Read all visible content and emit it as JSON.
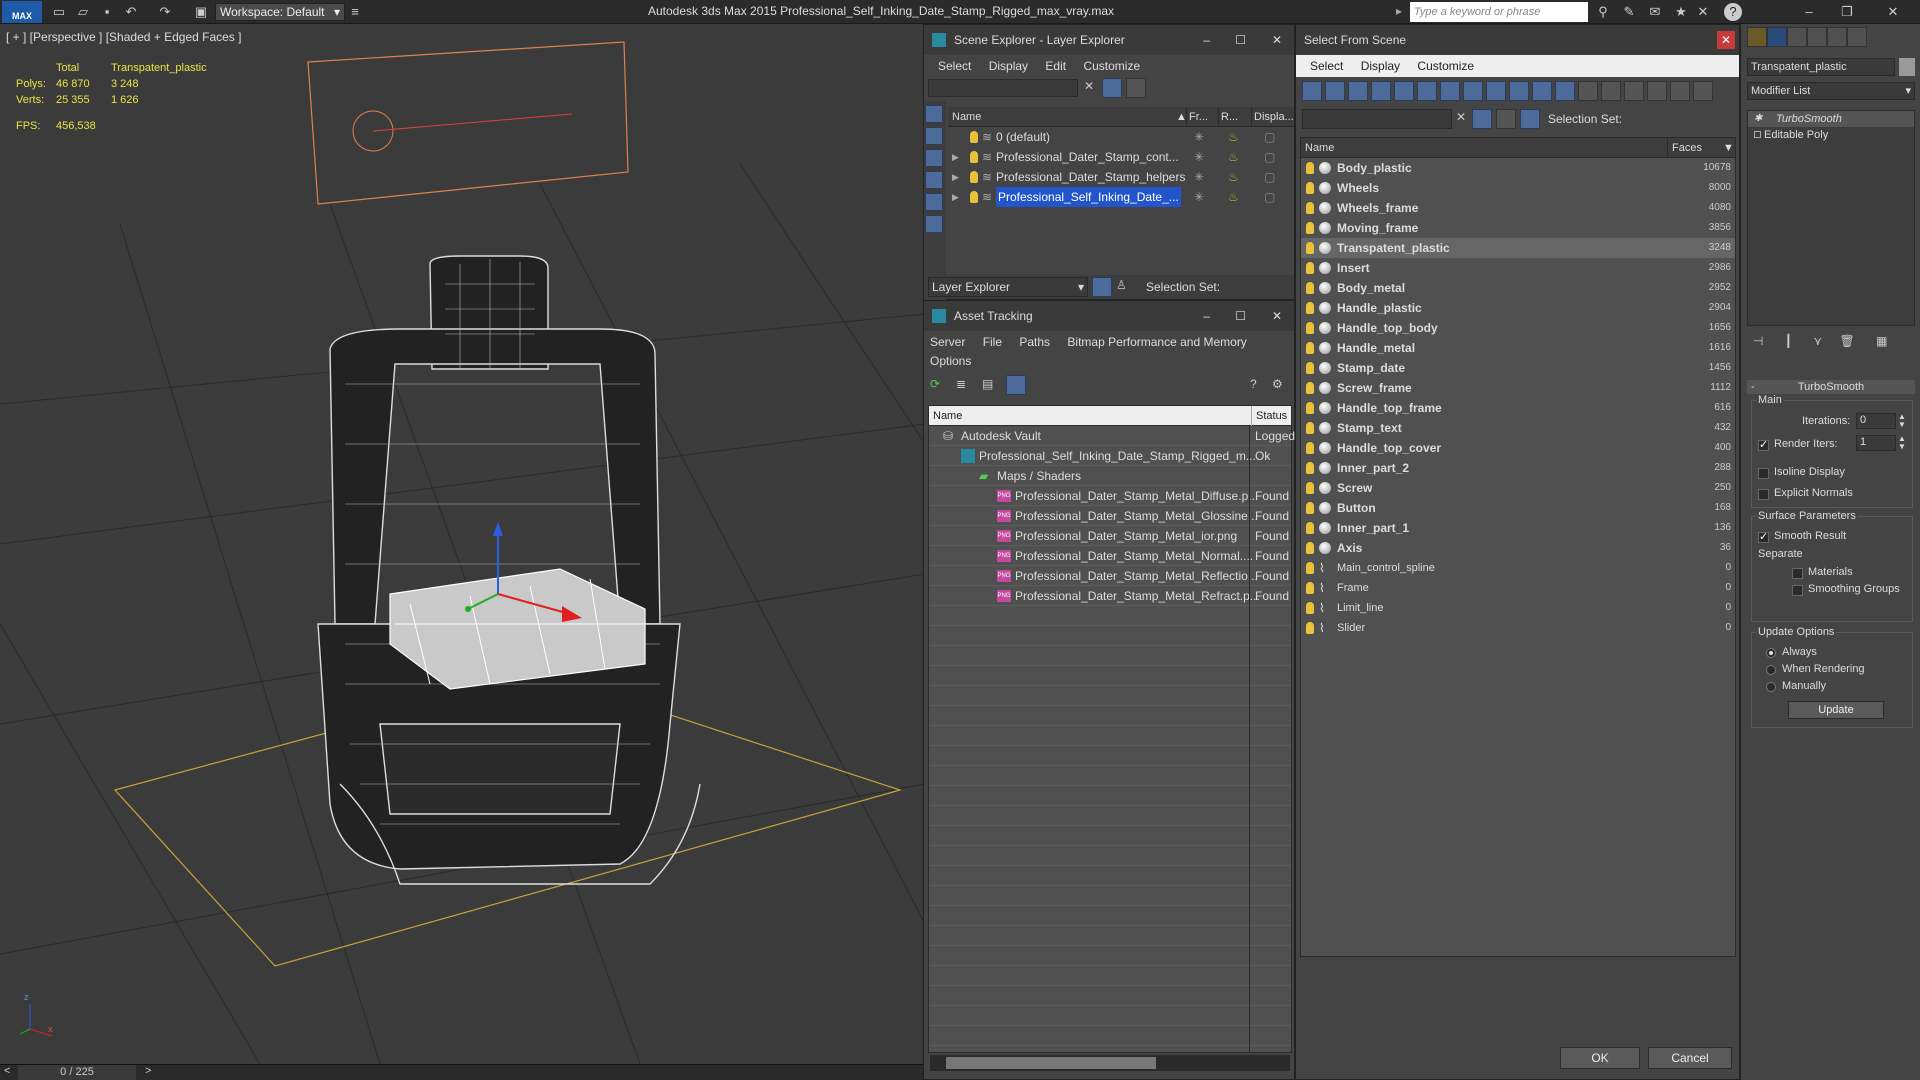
{
  "titlebar": {
    "logo": "MAX",
    "workspace": "Workspace: Default",
    "title": "Autodesk 3ds Max  2015     Professional_Self_Inking_Date_Stamp_Rigged_max_vray.max",
    "search_placeholder": "Type a keyword or phrase"
  },
  "viewport": {
    "label": "[ + ] [Perspective ] [Shaded + Edged Faces ]",
    "stats": {
      "total_label": "Total",
      "selected_label": "Transpatent_plastic",
      "polys_label": "Polys:",
      "polys_total": "46 870",
      "polys_sel": "3 248",
      "verts_label": "Verts:",
      "verts_total": "25 355",
      "verts_sel": "1 626",
      "fps_label": "FPS:",
      "fps_value": "456,538"
    },
    "axis_labels": {
      "z": "z",
      "x": "x"
    }
  },
  "timeline": {
    "frame": "0 / 225",
    "prev": "<",
    "next": ">"
  },
  "layer_explorer": {
    "title": "Scene Explorer - Layer Explorer",
    "menu": [
      "Select",
      "Display",
      "Edit",
      "Customize"
    ],
    "columns": {
      "name": "Name",
      "frozen": "Fr...",
      "render": "R...",
      "display": "Displa..."
    },
    "rows": [
      {
        "label": "0 (default)",
        "selected": false,
        "expand": false
      },
      {
        "label": "Professional_Dater_Stamp_cont...",
        "selected": false,
        "expand": true
      },
      {
        "label": "Professional_Dater_Stamp_helpers",
        "selected": false,
        "expand": true
      },
      {
        "label": "Professional_Self_Inking_Date_...",
        "selected": true,
        "expand": true
      }
    ],
    "footer_dropdown": "Layer Explorer",
    "selection_set_label": "Selection Set:"
  },
  "asset_tracking": {
    "title": "Asset Tracking",
    "menu": [
      "Server",
      "File",
      "Paths",
      "Bitmap Performance and Memory"
    ],
    "menu2": [
      "Options"
    ],
    "columns": {
      "name": "Name",
      "status": "Status"
    },
    "rows": [
      {
        "label": "Autodesk Vault",
        "status": "Logged",
        "indent": 0,
        "kind": "vault"
      },
      {
        "label": "Professional_Self_Inking_Date_Stamp_Rigged_m...",
        "status": "Ok",
        "indent": 1,
        "kind": "max"
      },
      {
        "label": "Maps / Shaders",
        "status": "",
        "indent": 2,
        "kind": "maps"
      },
      {
        "label": "Professional_Dater_Stamp_Metal_Diffuse.p...",
        "status": "Found",
        "indent": 3,
        "kind": "png"
      },
      {
        "label": "Professional_Dater_Stamp_Metal_Glossine...",
        "status": "Found",
        "indent": 3,
        "kind": "png"
      },
      {
        "label": "Professional_Dater_Stamp_Metal_ior.png",
        "status": "Found",
        "indent": 3,
        "kind": "png"
      },
      {
        "label": "Professional_Dater_Stamp_Metal_Normal....",
        "status": "Found",
        "indent": 3,
        "kind": "png"
      },
      {
        "label": "Professional_Dater_Stamp_Metal_Reflectio...",
        "status": "Found",
        "indent": 3,
        "kind": "png"
      },
      {
        "label": "Professional_Dater_Stamp_Metal_Refract.p...",
        "status": "Found",
        "indent": 3,
        "kind": "png"
      }
    ],
    "png_badge": "PNG"
  },
  "select_from_scene": {
    "title": "Select From Scene",
    "menu": [
      "Select",
      "Display",
      "Customize"
    ],
    "selection_set_label": "Selection Set:",
    "columns": {
      "name": "Name",
      "faces": "Faces"
    },
    "rows": [
      {
        "name": "Body_plastic",
        "faces": "10678",
        "bold": true,
        "selected": false,
        "kind": "sphere"
      },
      {
        "name": "Wheels",
        "faces": "8000",
        "bold": true,
        "selected": false,
        "kind": "sphere"
      },
      {
        "name": "Wheels_frame",
        "faces": "4080",
        "bold": true,
        "selected": false,
        "kind": "sphere"
      },
      {
        "name": "Moving_frame",
        "faces": "3856",
        "bold": true,
        "selected": false,
        "kind": "sphere"
      },
      {
        "name": "Transpatent_plastic",
        "faces": "3248",
        "bold": true,
        "selected": true,
        "kind": "sphere"
      },
      {
        "name": "Insert",
        "faces": "2986",
        "bold": true,
        "selected": false,
        "kind": "sphere"
      },
      {
        "name": "Body_metal",
        "faces": "2952",
        "bold": true,
        "selected": false,
        "kind": "sphere"
      },
      {
        "name": "Handle_plastic",
        "faces": "2904",
        "bold": true,
        "selected": false,
        "kind": "sphere"
      },
      {
        "name": "Handle_top_body",
        "faces": "1656",
        "bold": true,
        "selected": false,
        "kind": "sphere"
      },
      {
        "name": "Handle_metal",
        "faces": "1616",
        "bold": true,
        "selected": false,
        "kind": "sphere"
      },
      {
        "name": "Stamp_date",
        "faces": "1456",
        "bold": true,
        "selected": false,
        "kind": "sphere"
      },
      {
        "name": "Screw_frame",
        "faces": "1112",
        "bold": true,
        "selected": false,
        "kind": "sphere"
      },
      {
        "name": "Handle_top_frame",
        "faces": "616",
        "bold": true,
        "selected": false,
        "kind": "sphere"
      },
      {
        "name": "Stamp_text",
        "faces": "432",
        "bold": true,
        "selected": false,
        "kind": "sphere"
      },
      {
        "name": "Handle_top_cover",
        "faces": "400",
        "bold": true,
        "selected": false,
        "kind": "sphere"
      },
      {
        "name": "Inner_part_2",
        "faces": "288",
        "bold": true,
        "selected": false,
        "kind": "sphere"
      },
      {
        "name": "Screw",
        "faces": "250",
        "bold": true,
        "selected": false,
        "kind": "sphere"
      },
      {
        "name": "Button",
        "faces": "168",
        "bold": true,
        "selected": false,
        "kind": "sphere"
      },
      {
        "name": "Inner_part_1",
        "faces": "136",
        "bold": true,
        "selected": false,
        "kind": "sphere"
      },
      {
        "name": "Axis",
        "faces": "36",
        "bold": true,
        "selected": false,
        "kind": "sphere"
      },
      {
        "name": "Main_control_spline",
        "faces": "0",
        "bold": false,
        "selected": false,
        "kind": "shape"
      },
      {
        "name": "Frame",
        "faces": "0",
        "bold": false,
        "selected": false,
        "kind": "shape"
      },
      {
        "name": "Limit_line",
        "faces": "0",
        "bold": false,
        "selected": false,
        "kind": "shape"
      },
      {
        "name": "Slider",
        "faces": "0",
        "bold": false,
        "selected": false,
        "kind": "shape"
      }
    ],
    "ok": "OK",
    "cancel": "Cancel"
  },
  "command_panel": {
    "object_name": "Transpatent_plastic",
    "modifier_list": "Modifier List",
    "stack": [
      {
        "label": "TurboSmooth",
        "italic": true
      },
      {
        "label": "Editable Poly",
        "italic": false
      }
    ],
    "rollout_title": "TurboSmooth",
    "main_label": "Main",
    "iterations_label": "Iterations:",
    "iterations_value": "0",
    "render_iters_label": "Render Iters:",
    "render_iters_value": "1",
    "render_iters_checked": true,
    "isoline_label": "Isoline Display",
    "isoline_checked": false,
    "explicit_label": "Explicit Normals",
    "explicit_checked": false,
    "surface_label": "Surface Parameters",
    "smooth_label": "Smooth Result",
    "smooth_checked": true,
    "separate_label": "Separate",
    "materials_label": "Materials",
    "materials_checked": false,
    "smoothing_label": "Smoothing Groups",
    "smoothing_checked": false,
    "update_options_label": "Update Options",
    "always_label": "Always",
    "when_rendering_label": "When Rendering",
    "manually_label": "Manually",
    "update_selected": "Always",
    "update_button": "Update"
  },
  "colors": {
    "accent": "#2255cc",
    "highlight_sel": "#5a5a5a",
    "grid_line": "#222222",
    "wire": "#e6e6e6"
  }
}
